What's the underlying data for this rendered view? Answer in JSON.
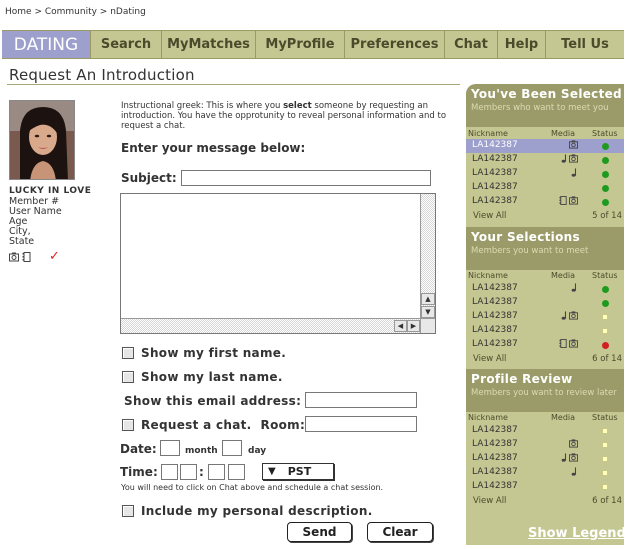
{
  "breadcrumb": "Home > Community > nDating",
  "nav": {
    "tabs": [
      {
        "label": "DATING",
        "active": true
      },
      {
        "label": "Search"
      },
      {
        "label": "MyMatches"
      },
      {
        "label": "MyProfile"
      },
      {
        "label": "Preferences"
      },
      {
        "label": "Chat"
      },
      {
        "label": "Help"
      },
      {
        "label": "Tell Us"
      }
    ]
  },
  "page": {
    "title": "Request An Introduction",
    "instructions_pre": "Instructional greek: This is where you ",
    "instructions_bold": "select",
    "instructions_post": " someone by requesting an introduction.  You have the opprotunity to reveal personal information and to request a chat.",
    "message_label": "Enter your message below:",
    "subject_label": "Subject:",
    "subject_value": "",
    "message_value": ""
  },
  "profile": {
    "name": "LUCKY IN LOVE",
    "meta": [
      "Member #",
      "User Name",
      "Age",
      "City,",
      "State"
    ],
    "check": "✓"
  },
  "options": {
    "show_first_name": "Show my first name.",
    "show_last_name": "Show my last name.",
    "email_label": "Show this email address:",
    "request_chat": "Request a chat.",
    "room_label": "Room:",
    "date_label": "Date:",
    "month_label": "month",
    "day_label": "day",
    "time_label": "Time:",
    "colon": ":",
    "timezone": "PST",
    "chat_note": "You will need to click on Chat above and schedule a chat session.",
    "include_description": "Include my personal description."
  },
  "buttons": {
    "send": "Send",
    "clear": "Clear"
  },
  "sidebar": {
    "col_nickname": "Nickname",
    "col_media": "Media",
    "col_status": "Status",
    "view_all": "View All",
    "show_legend": "Show Legend",
    "sections": [
      {
        "title": "You've Been Selected",
        "subtitle": "Members who want to meet you",
        "count": "5 of 14",
        "rows": [
          {
            "nick": "LA142387",
            "media": [
              "camera"
            ],
            "status": "green",
            "selected": true
          },
          {
            "nick": "LA142387",
            "media": [
              "note",
              "camera"
            ],
            "status": "green"
          },
          {
            "nick": "LA142387",
            "media": [
              "note"
            ],
            "status": "green"
          },
          {
            "nick": "LA142387",
            "media": [],
            "status": "green"
          },
          {
            "nick": "LA142387",
            "media": [
              "film",
              "camera"
            ],
            "status": "green"
          }
        ]
      },
      {
        "title": "Your Selections",
        "subtitle": "Members you want to meet",
        "count": "6 of 14",
        "rows": [
          {
            "nick": "LA142387",
            "media": [
              "note"
            ],
            "status": "green"
          },
          {
            "nick": "LA142387",
            "media": [],
            "status": "green"
          },
          {
            "nick": "LA142387",
            "media": [
              "note",
              "camera"
            ],
            "status": "yellow"
          },
          {
            "nick": "LA142387",
            "media": [],
            "status": "yellow"
          },
          {
            "nick": "LA142387",
            "media": [
              "film",
              "camera"
            ],
            "status": "red"
          }
        ]
      },
      {
        "title": "Profile Review",
        "subtitle": "Members you want to review later",
        "count": "6 of 14",
        "rows": [
          {
            "nick": "LA142387",
            "media": [],
            "status": "yellow"
          },
          {
            "nick": "LA142387",
            "media": [
              "camera"
            ],
            "status": "yellow"
          },
          {
            "nick": "LA142387",
            "media": [
              "note",
              "camera"
            ],
            "status": "yellow"
          },
          {
            "nick": "LA142387",
            "media": [
              "note"
            ],
            "status": "yellow"
          },
          {
            "nick": "LA142387",
            "media": [],
            "status": "yellow"
          }
        ]
      }
    ]
  }
}
